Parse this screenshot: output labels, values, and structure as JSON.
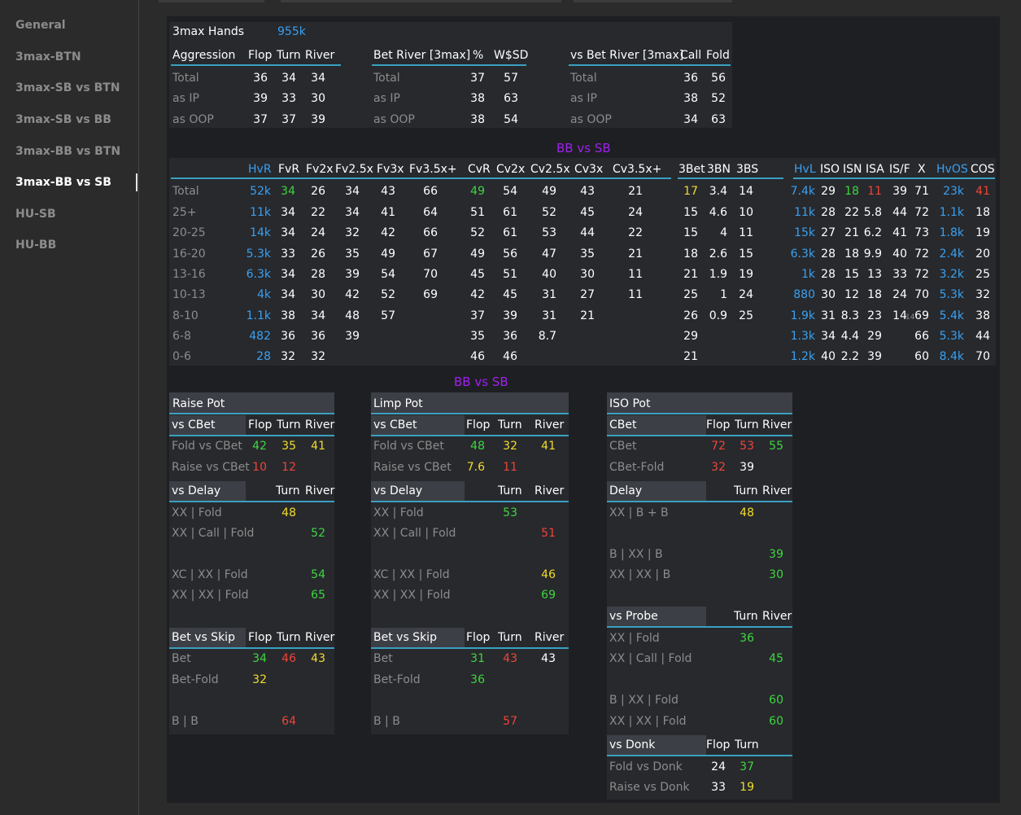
{
  "sidebar": {
    "items": [
      "General",
      "3max-BTN",
      "3max-SB vs BTN",
      "3max-SB vs BB",
      "3max-BB vs BTN",
      "3max-BB vs SB",
      "HU-SB",
      "HU-BB"
    ],
    "active_index": 5
  },
  "top": {
    "hands_label": "3max Hands",
    "hands_value": "955k",
    "aggression": {
      "headers": [
        "Aggression",
        "Flop",
        "Turn",
        "River"
      ],
      "rows": [
        [
          "Total",
          "36",
          "34",
          "34"
        ],
        [
          "as IP",
          "39",
          "33",
          "30"
        ],
        [
          "as OOP",
          "37",
          "37",
          "39"
        ]
      ]
    },
    "bet_river": {
      "headers": [
        "Bet River [3max]",
        "%",
        "W$SD"
      ],
      "rows": [
        [
          "Total",
          "37",
          "57"
        ],
        [
          "as IP",
          "38",
          "63"
        ],
        [
          "as OOP",
          "38",
          "54"
        ]
      ]
    },
    "vs_bet_river": {
      "headers": [
        "vs Bet River [3max]",
        "Call",
        "Fold"
      ],
      "rows": [
        [
          "Total",
          "36",
          "56"
        ],
        [
          "as IP",
          "38",
          "52"
        ],
        [
          "as OOP",
          "34",
          "63"
        ]
      ]
    }
  },
  "mid": {
    "title": "BB vs SB",
    "headers": [
      "HvR",
      "FvR",
      "Fv2x",
      "Fv2.5x",
      "Fv3x",
      "Fv3.5x+",
      "CvR",
      "Cv2x",
      "Cv2.5x",
      "Cv3x",
      "Cv3.5x+",
      "3Bet",
      "3BN",
      "3BS",
      "HvL",
      "ISO",
      "ISN",
      "ISA",
      "IS/F",
      "X",
      "HvOS",
      "COS"
    ],
    "rows": [
      [
        "Total",
        "52k",
        "34",
        "26",
        "34",
        "43",
        "66",
        "49",
        "54",
        "49",
        "43",
        "21",
        "17",
        "3.4",
        "14",
        "7.4k",
        "29",
        "18",
        "11",
        "39",
        "71",
        "23k",
        "41"
      ],
      [
        "25+",
        "11k",
        "34",
        "22",
        "34",
        "41",
        "64",
        "51",
        "61",
        "52",
        "45",
        "24",
        "15",
        "4.6",
        "10",
        "11k",
        "28",
        "22",
        "5.8",
        "44",
        "72",
        "1.1k",
        "18"
      ],
      [
        "20-25",
        "14k",
        "34",
        "24",
        "32",
        "42",
        "66",
        "52",
        "61",
        "53",
        "44",
        "22",
        "15",
        "4",
        "11",
        "15k",
        "27",
        "21",
        "6.2",
        "41",
        "73",
        "1.8k",
        "19"
      ],
      [
        "16-20",
        "5.3k",
        "33",
        "26",
        "35",
        "49",
        "67",
        "49",
        "56",
        "47",
        "35",
        "21",
        "18",
        "2.6",
        "15",
        "6.3k",
        "28",
        "18",
        "9.9",
        "40",
        "72",
        "2.4k",
        "20"
      ],
      [
        "13-16",
        "6.3k",
        "34",
        "28",
        "39",
        "54",
        "70",
        "45",
        "51",
        "40",
        "30",
        "11",
        "21",
        "1.9",
        "19",
        "1k",
        "28",
        "15",
        "13",
        "33",
        "72",
        "3.2k",
        "25"
      ],
      [
        "10-13",
        "4k",
        "34",
        "30",
        "42",
        "52",
        "69",
        "42",
        "45",
        "31",
        "27",
        "11",
        "25",
        "1",
        "24",
        "880",
        "30",
        "12",
        "18",
        "24",
        "70",
        "5.3k",
        "32"
      ],
      [
        "8-10",
        "1.1k",
        "38",
        "34",
        "48",
        "57",
        "",
        "37",
        "39",
        "31",
        "21",
        "",
        "26",
        "0.9",
        "25",
        "1.9k",
        "31",
        "8.3",
        "23",
        "14",
        "69",
        "5.4k",
        "38"
      ],
      [
        "6-8",
        "482",
        "36",
        "36",
        "39",
        "",
        "",
        "35",
        "36",
        "8.7",
        "",
        "",
        "29",
        "",
        "",
        "1.3k",
        "34",
        "4.4",
        "29",
        "",
        "66",
        "5.3k",
        "44"
      ],
      [
        "0-6",
        "28",
        "32",
        "32",
        "",
        "",
        "",
        "46",
        "46",
        "",
        "",
        "",
        "21",
        "",
        "",
        "1.2k",
        "40",
        "2.2",
        "39",
        "",
        "60",
        "8.4k",
        "70"
      ]
    ],
    "small_note": "14"
  },
  "bottom": {
    "title": "BB vs SB",
    "raise": {
      "title": "Raise Pot",
      "vs_cbet": {
        "headers": [
          "vs CBet",
          "Flop",
          "Turn",
          "River"
        ],
        "rows": [
          [
            "Fold vs CBet",
            "42",
            "35",
            "41"
          ],
          [
            "Raise vs CBet",
            "10",
            "12",
            ""
          ]
        ]
      },
      "vs_delay": {
        "headers": [
          "vs Delay",
          "Turn",
          "River"
        ],
        "rows": [
          [
            "XX | Fold",
            "48",
            ""
          ],
          [
            "XX | Call | Fold",
            "",
            "52"
          ],
          [
            "XC | XX | Fold",
            "",
            "54"
          ],
          [
            "XX | XX | Fold",
            "",
            "65"
          ]
        ]
      },
      "bet_skip": {
        "headers": [
          "Bet vs Skip",
          "Flop",
          "Turn",
          "River"
        ],
        "rows": [
          [
            "Bet",
            "34",
            "46",
            "43"
          ],
          [
            "Bet-Fold",
            "32",
            "",
            ""
          ],
          [
            "B | B",
            "",
            "64",
            ""
          ]
        ]
      }
    },
    "limp": {
      "title": "Limp Pot",
      "vs_cbet": {
        "headers": [
          "vs CBet",
          "Flop",
          "Turn",
          "River"
        ],
        "rows": [
          [
            "Fold vs CBet",
            "48",
            "32",
            "41"
          ],
          [
            "Raise vs CBet",
            "7.6",
            "11",
            ""
          ]
        ]
      },
      "vs_delay": {
        "headers": [
          "vs Delay",
          "Turn",
          "River"
        ],
        "rows": [
          [
            "XX | Fold",
            "53",
            ""
          ],
          [
            "XX | Call | Fold",
            "",
            "51"
          ],
          [
            "XC | XX | Fold",
            "",
            "46"
          ],
          [
            "XX | XX | Fold",
            "",
            "69"
          ]
        ]
      },
      "bet_skip": {
        "headers": [
          "Bet vs Skip",
          "Flop",
          "Turn",
          "River"
        ],
        "rows": [
          [
            "Bet",
            "31",
            "43",
            "43"
          ],
          [
            "Bet-Fold",
            "36",
            "",
            ""
          ],
          [
            "B | B",
            "",
            "57",
            ""
          ]
        ]
      }
    },
    "iso": {
      "title": "ISO Pot",
      "cbet": {
        "headers": [
          "CBet",
          "Flop",
          "Turn",
          "River"
        ],
        "rows": [
          [
            "CBet",
            "72",
            "53",
            "55"
          ],
          [
            "CBet-Fold",
            "32",
            "39",
            ""
          ]
        ]
      },
      "delay": {
        "headers": [
          "Delay",
          "Turn",
          "River"
        ],
        "rows": [
          [
            "XX | B + B",
            "48",
            ""
          ],
          [
            "B | XX | B",
            "",
            "39"
          ],
          [
            "XX | XX | B",
            "",
            "30"
          ]
        ]
      },
      "vs_probe": {
        "headers": [
          "vs Probe",
          "Turn",
          "River"
        ],
        "rows": [
          [
            "XX | Fold",
            "36",
            ""
          ],
          [
            "XX | Call | Fold",
            "",
            "45"
          ],
          [
            "B | XX | Fold",
            "",
            "60"
          ],
          [
            "XX | XX | Fold",
            "",
            "60"
          ]
        ]
      },
      "vs_donk": {
        "headers": [
          "vs Donk",
          "Flop",
          "Turn"
        ],
        "rows": [
          [
            "Fold vs Donk",
            "24",
            "37"
          ],
          [
            "Raise vs Donk",
            "33",
            "19"
          ]
        ]
      }
    }
  },
  "colors": {
    "blue": "#3aa0f0",
    "green": "#3fd63f",
    "red": "#f04438",
    "yellow": "#f2dc2a",
    "purple": "#a020f0",
    "background": "#1e1f22"
  }
}
